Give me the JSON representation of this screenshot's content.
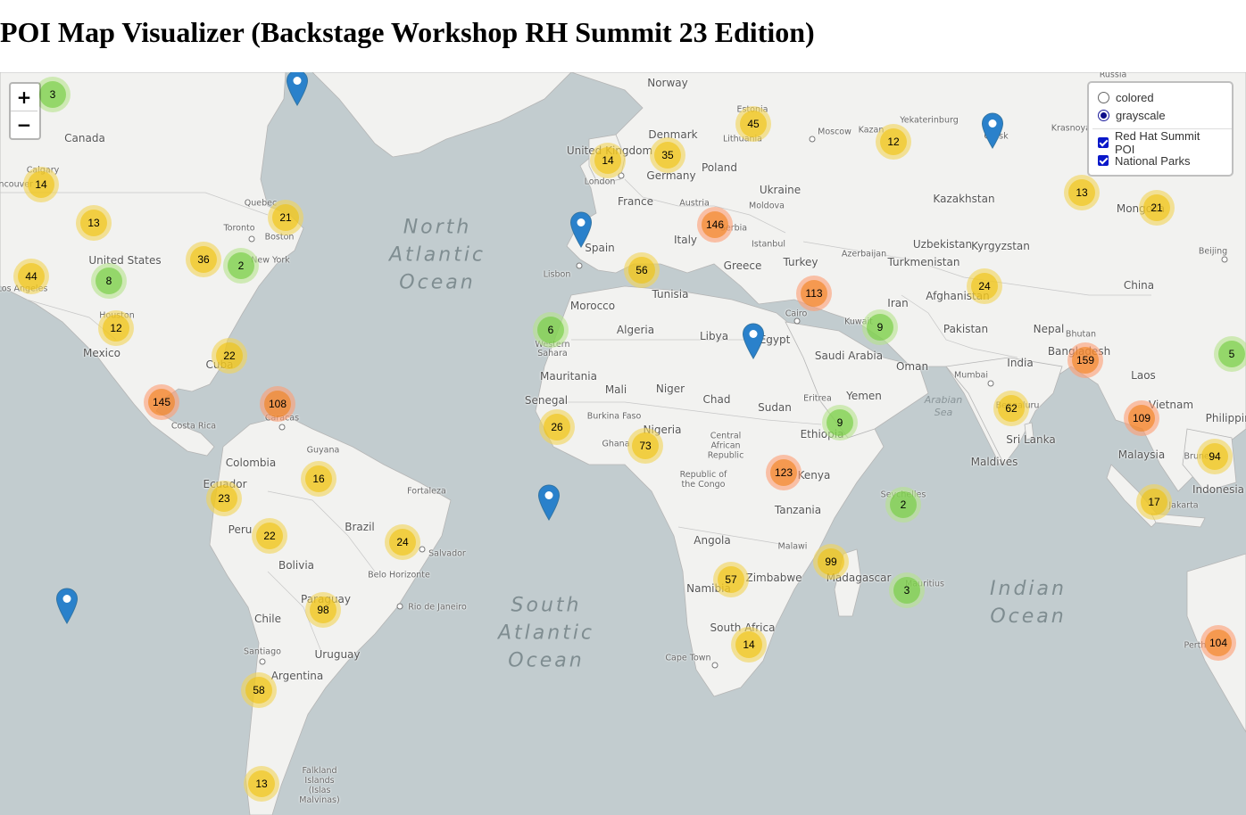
{
  "page": {
    "title": "POI Map Visualizer (Backstage Workshop RH Summit 23 Edition)"
  },
  "zoom": {
    "in_label": "+",
    "out_label": "−"
  },
  "layer_control": {
    "base_layers": [
      {
        "label": "colored",
        "selected": false
      },
      {
        "label": "grayscale",
        "selected": true
      }
    ],
    "overlays": [
      {
        "label": "Red Hat Summit POI",
        "checked": true
      },
      {
        "label": "National Parks",
        "checked": true
      }
    ]
  },
  "map_labels": {
    "oceans": [
      "North Atlantic Ocean",
      "South Atlantic Ocean",
      "Indian Ocean"
    ],
    "seas": [
      "Arabian Sea"
    ],
    "countries": [
      "Canada",
      "United States",
      "Mexico",
      "Cuba",
      "Colombia",
      "Ecuador",
      "Peru",
      "Brazil",
      "Bolivia",
      "Paraguay",
      "Chile",
      "Argentina",
      "Uruguay",
      "Guyana",
      "Norway",
      "United Kingdom",
      "Denmark",
      "Lithuania",
      "Estonia",
      "Germany",
      "Poland",
      "Ukraine",
      "Moldova",
      "France",
      "Austria",
      "Serbia",
      "Italy",
      "Spain",
      "Greece",
      "Turkey",
      "Tunisia",
      "Morocco",
      "Algeria",
      "Libya",
      "Egypt",
      "Western Sahara",
      "Mauritania",
      "Mali",
      "Niger",
      "Chad",
      "Sudan",
      "Senegal",
      "Burkina Faso",
      "Ghana",
      "Nigeria",
      "Central African Republic",
      "Ethiopia",
      "Eritrea",
      "Kenya",
      "Tanzania",
      "Republic of the Congo",
      "Angola",
      "Malawi",
      "Zimbabwe",
      "Namibia",
      "South Africa",
      "Madagascar",
      "Mauritius",
      "Saudi Arabia",
      "Yemen",
      "Oman",
      "Iran",
      "Kuwait",
      "Azerbaijan",
      "Uzbekistan",
      "Kyrgyzstan",
      "Turkmenistan",
      "Afghanistan",
      "Pakistan",
      "India",
      "Nepal",
      "Bhutan",
      "Bangladesh",
      "Sri Lanka",
      "Maldives",
      "Kazakhstan",
      "Mongolia",
      "China",
      "Russia",
      "Laos",
      "Vietnam",
      "Philippines",
      "Malaysia",
      "Brunei",
      "Indonesia",
      "Seychelles"
    ],
    "cities": [
      "Calgary",
      "Vancouver",
      "Los Angeles",
      "Houston",
      "Toronto",
      "Quebec",
      "Boston",
      "New York",
      "Caracas",
      "Costa Rica",
      "Fortaleza",
      "Salvador",
      "Belo Horizonte",
      "Rio de Janeiro",
      "Santiago",
      "Falkland Islands (Islas Malvinas)",
      "London",
      "Lisbon",
      "Istanbul",
      "Moscow",
      "Kazan",
      "Yekaterinburg",
      "Omsk",
      "Krasnoyarsk",
      "Cairo",
      "Mumbai",
      "Bengaluru",
      "Beijing",
      "Jakarta",
      "Perth",
      "Cape Town"
    ]
  },
  "clusters": [
    {
      "count": "3",
      "size": "small"
    },
    {
      "count": "14",
      "size": "medium"
    },
    {
      "count": "13",
      "size": "medium"
    },
    {
      "count": "21",
      "size": "medium"
    },
    {
      "count": "44",
      "size": "medium"
    },
    {
      "count": "8",
      "size": "small"
    },
    {
      "count": "36",
      "size": "medium"
    },
    {
      "count": "2",
      "size": "small"
    },
    {
      "count": "12",
      "size": "medium"
    },
    {
      "count": "22",
      "size": "medium"
    },
    {
      "count": "145",
      "size": "large"
    },
    {
      "count": "108",
      "size": "large"
    },
    {
      "count": "16",
      "size": "medium"
    },
    {
      "count": "23",
      "size": "medium"
    },
    {
      "count": "22",
      "size": "medium"
    },
    {
      "count": "24",
      "size": "medium"
    },
    {
      "count": "98",
      "size": "medium"
    },
    {
      "count": "58",
      "size": "medium"
    },
    {
      "count": "13",
      "size": "medium"
    },
    {
      "count": "14",
      "size": "medium"
    },
    {
      "count": "35",
      "size": "medium"
    },
    {
      "count": "45",
      "size": "medium"
    },
    {
      "count": "146",
      "size": "large"
    },
    {
      "count": "56",
      "size": "medium"
    },
    {
      "count": "6",
      "size": "small"
    },
    {
      "count": "26",
      "size": "medium"
    },
    {
      "count": "73",
      "size": "medium"
    },
    {
      "count": "113",
      "size": "large"
    },
    {
      "count": "9",
      "size": "small"
    },
    {
      "count": "9",
      "size": "small"
    },
    {
      "count": "123",
      "size": "large"
    },
    {
      "count": "2",
      "size": "small"
    },
    {
      "count": "99",
      "size": "medium"
    },
    {
      "count": "3",
      "size": "small"
    },
    {
      "count": "57",
      "size": "medium"
    },
    {
      "count": "14",
      "size": "medium"
    },
    {
      "count": "12",
      "size": "medium"
    },
    {
      "count": "13",
      "size": "medium"
    },
    {
      "count": "21",
      "size": "medium"
    },
    {
      "count": "24",
      "size": "medium"
    },
    {
      "count": "62",
      "size": "medium"
    },
    {
      "count": "159",
      "size": "large"
    },
    {
      "count": "109",
      "size": "large"
    },
    {
      "count": "94",
      "size": "medium"
    },
    {
      "count": "17",
      "size": "medium"
    },
    {
      "count": "5",
      "size": "small"
    },
    {
      "count": "104",
      "size": "large"
    }
  ],
  "markers": [
    {
      "icon": "map-pin-icon",
      "color": "#2a81cb"
    },
    {
      "icon": "map-pin-icon",
      "color": "#2a81cb"
    },
    {
      "icon": "map-pin-icon",
      "color": "#2a81cb"
    },
    {
      "icon": "map-pin-icon",
      "color": "#2a81cb"
    },
    {
      "icon": "map-pin-icon",
      "color": "#2a81cb"
    },
    {
      "icon": "map-pin-icon",
      "color": "#2a81cb"
    }
  ],
  "colors": {
    "ocean": "#c2cccf",
    "land": "#f2f2f0",
    "border": "#b8b8b8",
    "marker": "#2a81cb"
  }
}
